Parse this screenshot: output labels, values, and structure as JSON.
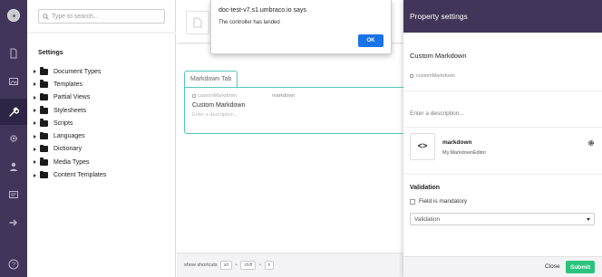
{
  "search": {
    "placeholder": "Type to search..."
  },
  "tree": {
    "root_label": "Settings",
    "items": [
      {
        "label": "Document Types"
      },
      {
        "label": "Templates"
      },
      {
        "label": "Partial Views"
      },
      {
        "label": "Stylesheets"
      },
      {
        "label": "Scripts"
      },
      {
        "label": "Languages"
      },
      {
        "label": "Dictionary"
      },
      {
        "label": "Media Types"
      },
      {
        "label": "Content Templates"
      }
    ]
  },
  "rail": {
    "items": [
      {
        "name": "content-icon"
      },
      {
        "name": "media-icon"
      },
      {
        "name": "settings-wrench-icon",
        "active": true
      },
      {
        "name": "developer-gear-icon"
      },
      {
        "name": "users-icon"
      },
      {
        "name": "members-icon"
      },
      {
        "name": "forms-arrow-icon"
      },
      {
        "name": "help-icon"
      }
    ]
  },
  "editor": {
    "tab_label": "Markdown Tab",
    "property_alias": "customMarkdown",
    "property_name": "Custom Markdown",
    "property_desc": "Enter a description...",
    "property_editor": "markdown"
  },
  "shortcuts": {
    "label": "show shortcuts",
    "keys": [
      "alt",
      "shift",
      "k"
    ],
    "plus": "+"
  },
  "alert": {
    "title": "doc-test-v7.s1.umbraco.io says",
    "message": "The controller has landed",
    "ok_label": "OK"
  },
  "panel": {
    "title": "Property settings",
    "property_name": "Custom Markdown",
    "property_alias": "customMarkdown",
    "description_placeholder": "Enter a description...",
    "editor_icon": "<>",
    "editor_name": "markdown",
    "editor_alias": "My.MarkdownEditor",
    "validation_title": "Validation",
    "mandatory_label": "Field is mandatory",
    "validation_select": "Validation",
    "close_label": "Close",
    "submit_label": "Submit"
  },
  "colors": {
    "rail_bg": "#413659",
    "panel_header_bg": "#413659",
    "tab_border": "#54c7be",
    "ok_button": "#1a73e8",
    "submit_button": "#2bc37c"
  }
}
